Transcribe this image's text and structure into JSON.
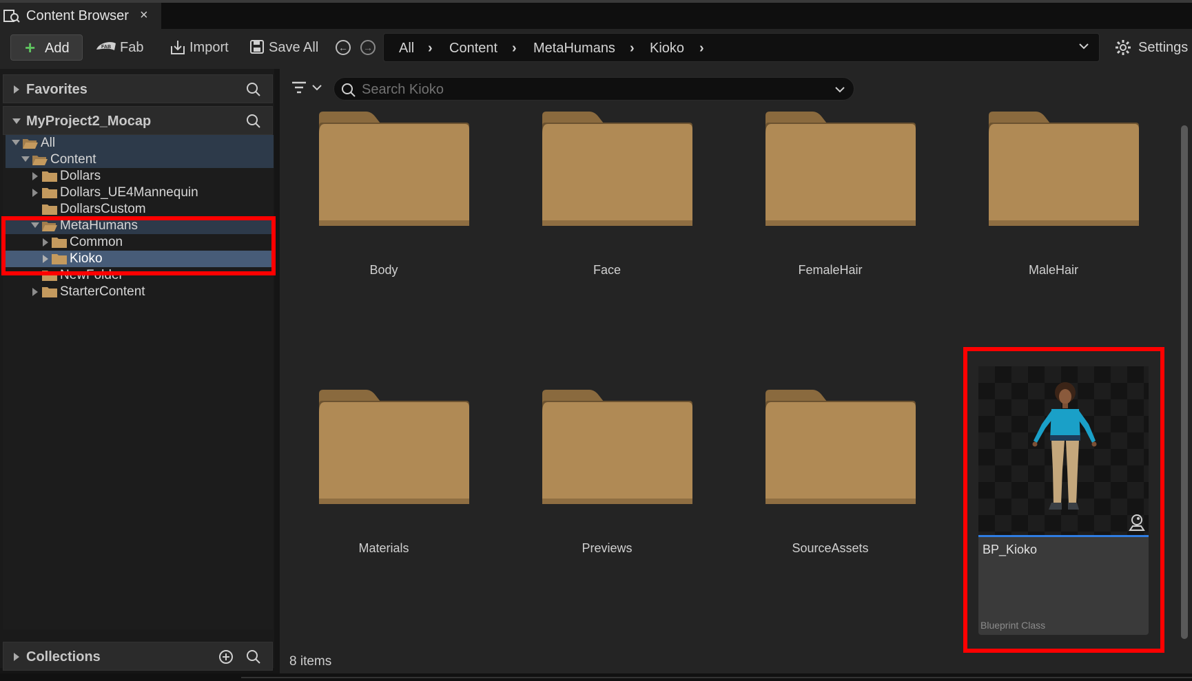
{
  "tab": {
    "title": "Content Browser",
    "close": "×"
  },
  "toolbar": {
    "add_label": "Add",
    "fab_label": "Fab",
    "import_label": "Import",
    "save_all_label": "Save All",
    "settings_label": "Settings"
  },
  "breadcrumb": [
    "All",
    "Content",
    "MetaHumans",
    "Kioko"
  ],
  "left_panel": {
    "favorites_label": "Favorites",
    "project_label": "MyProject2_Mocap",
    "collections_label": "Collections",
    "tree": [
      {
        "label": "All",
        "expanded": true
      },
      {
        "label": "Content",
        "expanded": true
      },
      {
        "label": "Dollars",
        "expanded": false
      },
      {
        "label": "Dollars_UE4Mannequin",
        "expanded": false
      },
      {
        "label": "DollarsCustom",
        "expanded": false
      },
      {
        "label": "MetaHumans",
        "expanded": true
      },
      {
        "label": "Common",
        "expanded": false
      },
      {
        "label": "Kioko",
        "expanded": false,
        "selected": true
      },
      {
        "label": "NewFolder",
        "expanded": false
      },
      {
        "label": "StarterContent",
        "expanded": false
      }
    ]
  },
  "search": {
    "placeholder": "Search Kioko"
  },
  "folders": [
    "Body",
    "Face",
    "FemaleHair",
    "MaleHair",
    "Materials",
    "Previews",
    "SourceAssets"
  ],
  "asset": {
    "name": "BP_Kioko",
    "type": "Blueprint Class"
  },
  "status": {
    "items_count": "8 items"
  },
  "colors": {
    "folder": "#b08a55",
    "selection": "#475c78",
    "highlight_box": "#ff0000",
    "asset_bar": "#2f7de3",
    "add_plus": "#5fc35f"
  }
}
